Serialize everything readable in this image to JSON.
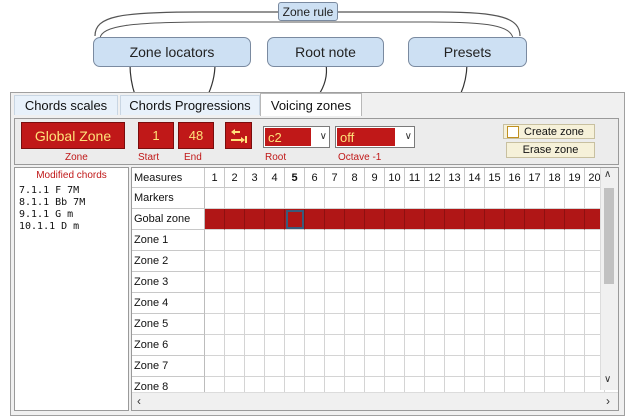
{
  "callouts": {
    "zone_rule": "Zone rule",
    "zone_locators": "Zone locators",
    "root_note": "Root note",
    "presets": "Presets"
  },
  "tabs": [
    {
      "label": "Chords scales",
      "active": false
    },
    {
      "label": "Chords Progressions",
      "active": false
    },
    {
      "label": "Voicing zones",
      "active": true
    }
  ],
  "toolbar": {
    "zone_value": "Global Zone",
    "zone_label": "Zone",
    "start_value": "1",
    "start_label": "Start",
    "end_value": "48",
    "end_label": "End",
    "root_value": "c2",
    "root_label": "Root",
    "preset_value": "off",
    "preset_label": "Octave -1",
    "create_zone_label": "Create zone",
    "create_zone_checked": false,
    "erase_zone_label": "Erase zone",
    "icon": "jump-to-end-icon"
  },
  "modified_chords": {
    "title": "Modified chords",
    "items": [
      "7.1.1 F 7M",
      "8.1.1 Bb 7M",
      "9.1.1 G m",
      "10.1.1 D m"
    ]
  },
  "grid": {
    "header_label": "Measures",
    "measures": [
      "1",
      "2",
      "3",
      "4",
      "5",
      "6",
      "7",
      "8",
      "9",
      "10",
      "11",
      "12",
      "13",
      "14",
      "15",
      "16",
      "17",
      "18",
      "19",
      "20"
    ],
    "bold_measure": "5",
    "rows": [
      "Markers",
      "Gobal zone",
      "Zone  1",
      "Zone  2",
      "Zone  3",
      "Zone  4",
      "Zone  5",
      "Zone  6",
      "Zone  7",
      "Zone  8"
    ],
    "filled_row": "Gobal zone",
    "selected_measure": "5"
  },
  "colors": {
    "accent_red": "#c01818",
    "accent_text": "#ffe27a",
    "callout_bg": "#cde0f3",
    "tab_bg": "#e8f1fa"
  }
}
